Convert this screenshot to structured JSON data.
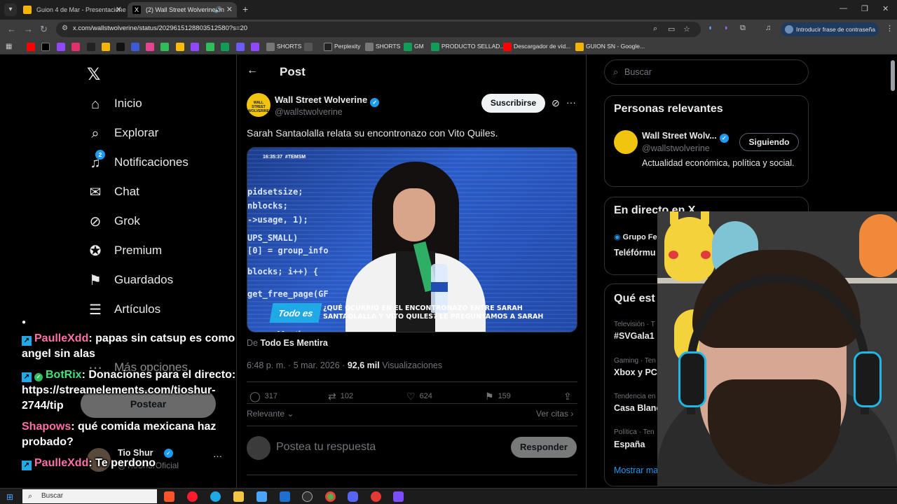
{
  "browser": {
    "tabs": [
      {
        "label": "Guion 4 de Mar - Presentacione",
        "color": "#f4b400"
      },
      {
        "label": "(2) Wall Street Wolverine en",
        "color": "#000000"
      }
    ],
    "new_tab": "+",
    "url": "x.com/wallstwolverine/status/2029615128803512580?s=20",
    "password_prompt": "Introducir frase de contraseña",
    "bookmarks": [
      {
        "label": "SHORTS",
        "color": "#777777"
      },
      {
        "label": "Perplexity",
        "color": "#222222"
      },
      {
        "label": "SHORTS",
        "color": "#777777"
      },
      {
        "label": "GM",
        "color": "#0f9d58"
      },
      {
        "label": "PRODUCTO SELLAD...",
        "color": "#0f9d58"
      },
      {
        "label": "Descargador de víd...",
        "color": "#ff0000"
      },
      {
        "label": "GUION SN - Google...",
        "color": "#f4b400"
      }
    ]
  },
  "sidebar": {
    "items": [
      {
        "label": "Inicio",
        "icon": "home-icon"
      },
      {
        "label": "Explorar",
        "icon": "search-icon"
      },
      {
        "label": "Notificaciones",
        "icon": "bell-icon",
        "badge": "2"
      },
      {
        "label": "Chat",
        "icon": "mail-icon"
      },
      {
        "label": "Grok",
        "icon": "grok-icon"
      },
      {
        "label": "Premium",
        "icon": "premium-icon"
      },
      {
        "label": "Guardados",
        "icon": "bookmark-icon"
      },
      {
        "label": "Artículos",
        "icon": "articles-icon"
      },
      {
        "label": "Más opciones",
        "icon": "more-options-icon"
      }
    ],
    "post_button": "Postear",
    "account": {
      "name": "Tio Shur",
      "handle": "@TioShurOficial"
    }
  },
  "post": {
    "header_title": "Post",
    "author_name": "Wall Street Wolverine",
    "author_handle": "@wallstwolverine",
    "avatar_text": "WALL STREET WOLVERINE",
    "subscribe_label": "Suscribirse",
    "text": "Sarah Santaolalla relata su encontronazo con Vito Quiles.",
    "video": {
      "timestamp": "16:35:37",
      "hashtag": "#TEMSM",
      "code_lines": [
        "pidsetsize;",
        "nblocks;",
        "->usage, 1);",
        "UPS_SMALL)",
        "[0] = group_info",
        "blocks; i++) {",
        "get_free_page(GF"
      ],
      "show_logo": "Todo es Mentira",
      "caption_line1": "¿QUÉ OCURRIÓ EN EL ENCONTRONAZO ENTRE SARAH",
      "caption_line2": "SANTAOLALLA Y VITO QUILES? LE PREGUNTAMOS A SARAH"
    },
    "from_prefix": "De",
    "from_source": "Todo Es Mentira",
    "time": "6:48 p. m. · 5 mar. 2026 ·",
    "views": "92,6 mil",
    "views_label": "Visualizaciones",
    "actions": {
      "replies": "317",
      "reposts": "102",
      "likes": "624",
      "bookmarks": "159"
    },
    "sort_label": "Relevante",
    "quotes_label": "Ver citas",
    "reply_placeholder": "Postea tu respuesta",
    "reply_button": "Responder"
  },
  "right": {
    "search_placeholder": "Buscar",
    "relevant_title": "Personas relevantes",
    "relevant_person": {
      "name": "Wall Street Wolv...",
      "handle": "@wallstwolverine",
      "follow_label": "Siguiendo",
      "bio": "Actualidad económica, política y social."
    },
    "live_title": "En directo en X",
    "live_items": [
      "Grupo Fe",
      "Teléfórmu"
    ],
    "trends_title": "Qué est",
    "trends": [
      {
        "category": "Televisión · T",
        "name": "#SVGala1"
      },
      {
        "category": "Gaming · Ten",
        "name": "Xbox y PC"
      },
      {
        "category": "Tendencia en",
        "name": "Casa Blanc"
      },
      {
        "category": "Política · Ten",
        "name": "España"
      }
    ],
    "show_more": "Mostrar ma"
  },
  "chat": [
    {
      "user": "PaulleXdd",
      "text": ": papas sin catsup es como angel sin alas",
      "user_color": "#ff6fa8"
    },
    {
      "user": "BotRix",
      "text": ": Donaciones para el directo: https://streamelements.com/tioshur-2744/tip",
      "user_color": "#45e07a"
    },
    {
      "user": "Shapows",
      "text": ": qué comida mexicana haz probado?",
      "user_color": "#ff6fa8"
    },
    {
      "user": "PaulleXdd",
      "text": ": Te perdono",
      "user_color": "#ff6fa8"
    }
  ],
  "taskbar": {
    "search_placeholder": "Buscar"
  }
}
